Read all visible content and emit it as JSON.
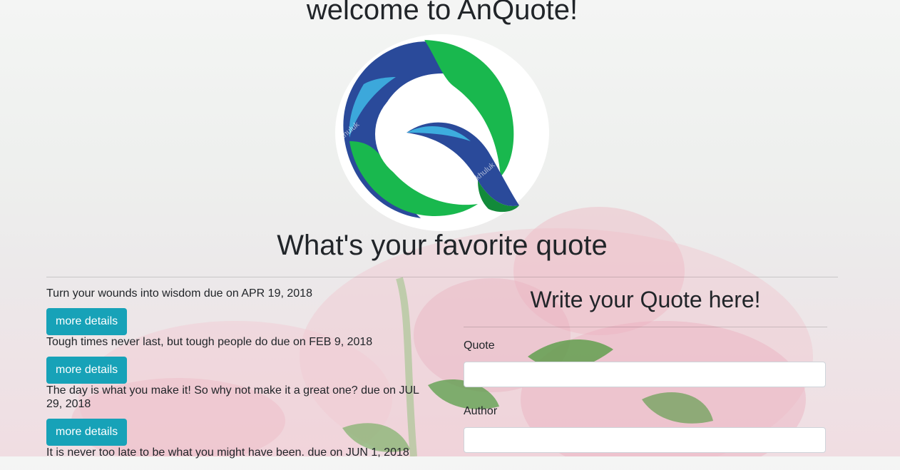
{
  "header": {
    "site_title": "welcome to AnQuote!",
    "subtitle": "What's your favorite quote"
  },
  "logo": {
    "watermark": "khuluk"
  },
  "quotes": [
    {
      "text": "Turn your wounds into wisdom due on APR 19, 2018",
      "button": "more details"
    },
    {
      "text": "Tough times never last, but tough people do due on FEB 9, 2018",
      "button": "more details"
    },
    {
      "text": "The day is what you make it! So why not make it a great one? due on JUL 29, 2018",
      "button": "more details"
    },
    {
      "text": "It is never too late to be what you might have been. due on JUN 1, 2018",
      "button": "more details"
    }
  ],
  "form": {
    "title": "Write your Quote here!",
    "quote_label": "Quote",
    "quote_value": "",
    "author_label": "Author",
    "author_value": ""
  },
  "colors": {
    "button": "#17a2b8",
    "logo_blue": "#2a4a9a",
    "logo_green": "#19b84e"
  }
}
